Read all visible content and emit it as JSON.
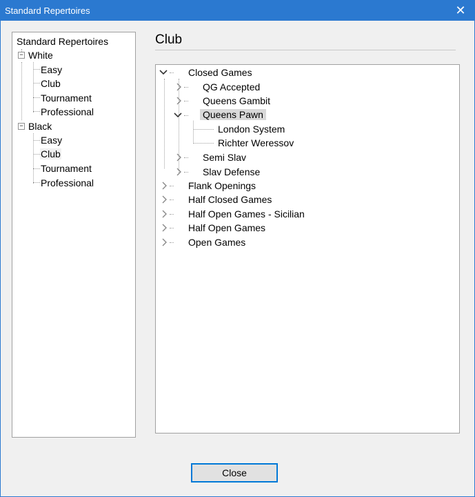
{
  "window": {
    "title": "Standard Repertoires",
    "close_glyph": "✕"
  },
  "left_tree": {
    "root": "Standard Repertoires",
    "groups": [
      {
        "label": "White",
        "expanded": true,
        "toggle": "−",
        "items": [
          "Easy",
          "Club",
          "Tournament",
          "Professional"
        ]
      },
      {
        "label": "Black",
        "expanded": true,
        "toggle": "−",
        "items": [
          "Easy",
          "Club",
          "Tournament",
          "Professional"
        ]
      }
    ],
    "selected": "Black/Club"
  },
  "heading": "Club",
  "right_tree": {
    "nodes": [
      {
        "label": "Closed Games",
        "expanded": true,
        "children": [
          {
            "label": "QG Accepted",
            "expanded": false
          },
          {
            "label": "Queens Gambit",
            "expanded": false
          },
          {
            "label": "Queens Pawn",
            "expanded": true,
            "selected": true,
            "children": [
              {
                "label": "London System"
              },
              {
                "label": "Richter Weressov"
              }
            ]
          },
          {
            "label": "Semi Slav",
            "expanded": false
          },
          {
            "label": "Slav Defense",
            "expanded": false
          }
        ]
      },
      {
        "label": "Flank Openings",
        "expanded": false
      },
      {
        "label": "Half Closed Games",
        "expanded": false
      },
      {
        "label": "Half Open Games - Sicilian",
        "expanded": false
      },
      {
        "label": "Half Open Games",
        "expanded": false
      },
      {
        "label": "Open Games",
        "expanded": false
      }
    ]
  },
  "footer": {
    "close_label": "Close"
  },
  "colors": {
    "titlebar": "#2b79d0",
    "selection": "#d9d9d9",
    "button_border": "#0078d7"
  }
}
